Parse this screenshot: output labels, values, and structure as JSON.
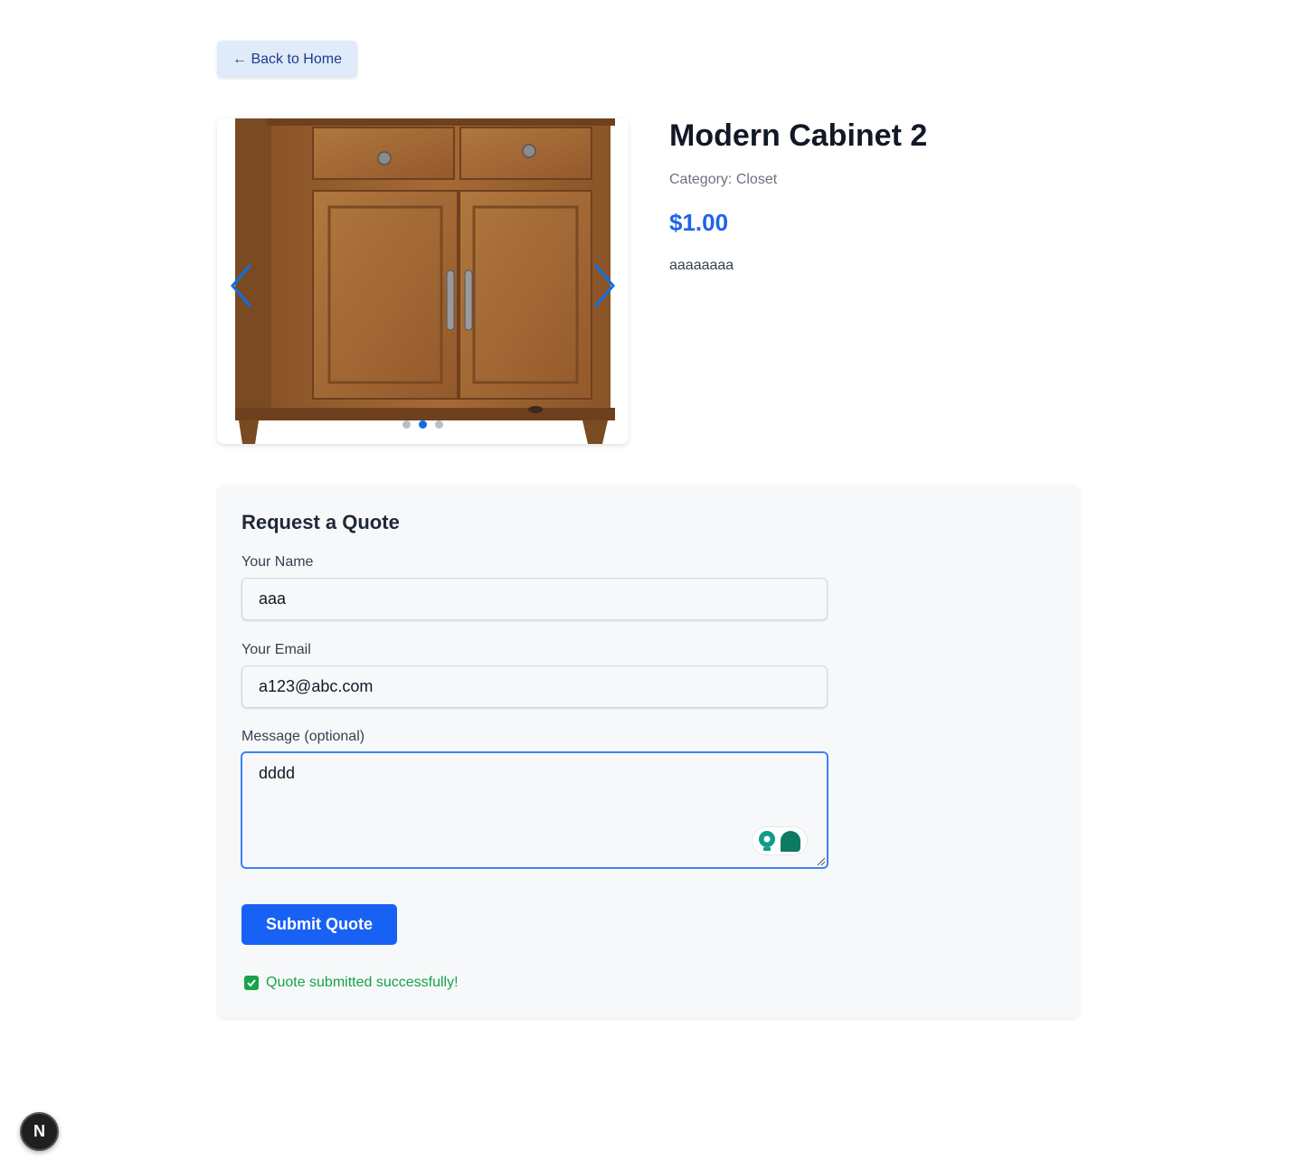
{
  "nav": {
    "back_label": "← Back to Home"
  },
  "product": {
    "title": "Modern Cabinet 2",
    "category": "Category: Closet",
    "price": "$1.00",
    "description": "aaaaaaaa",
    "carousel": {
      "total_slides": 3,
      "active_slide": 2
    }
  },
  "quote": {
    "heading": "Request a Quote",
    "name_label": "Your Name",
    "name_value": "aaa",
    "email_label": "Your Email",
    "email_value": "a123@abc.com",
    "message_label": "Message (optional)",
    "message_value": "dddd",
    "submit_label": "Submit Quote",
    "success_message": "Quote submitted successfully!"
  },
  "dev_badge": {
    "letter": "N"
  },
  "colors": {
    "accent": "#1861f5",
    "price": "#1d64e8",
    "success": "#16a34a",
    "carousel_arrow": "#0b6fe8"
  }
}
